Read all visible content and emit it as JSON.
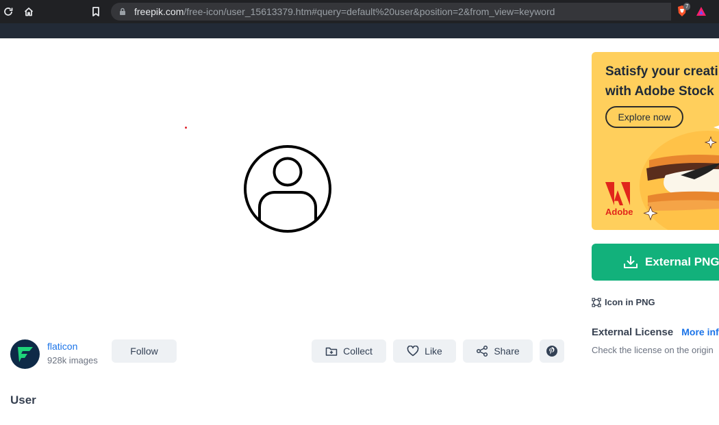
{
  "browser": {
    "url_host": "freepik.com",
    "url_path": "/free-icon/user_15613379.htm#query=default%20user&position=2&from_view=keyword",
    "extension_badge": "7"
  },
  "author": {
    "name": "flaticon",
    "count": "928k images"
  },
  "actions": {
    "follow": "Follow",
    "collect": "Collect",
    "like": "Like",
    "share": "Share"
  },
  "page_title": "User",
  "ad": {
    "title_line1": "Satisfy your creati",
    "title_line2": "with Adobe Stock",
    "button": "Explore now",
    "brand": "Adobe",
    "colors": {
      "background": "#ffcf5c",
      "brand": "#e1251b"
    }
  },
  "download": {
    "label": "External PNG",
    "color": "#12b17b"
  },
  "format_info": "Icon in PNG",
  "license": {
    "title": "External License",
    "link": "More inf",
    "description": "Check the license on the origin"
  }
}
